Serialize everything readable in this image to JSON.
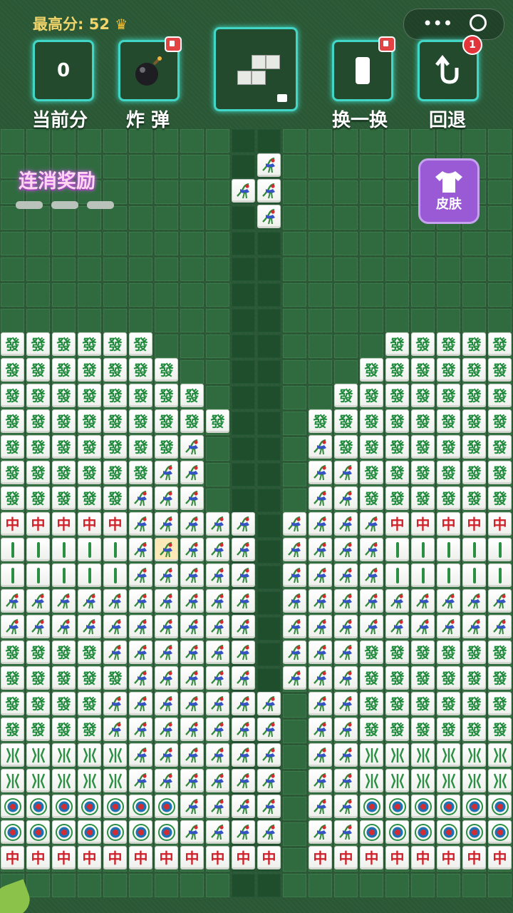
{
  "hud": {
    "best_label": "最高分:",
    "best_value": "52",
    "score_value": "0",
    "score_label": "当前分",
    "bomb_label": "炸 弹",
    "swap_label": "换一换",
    "undo_label": "回退",
    "undo_count": "1",
    "skin_label": "皮肤",
    "streak_label": "连消奖励"
  },
  "colors": {
    "accent": "#41d6c6",
    "tile_green": "#1f8a3c",
    "tile_red": "#d0202a",
    "skin_purple": "#9a5ad6"
  },
  "icons": [
    "bomb-icon",
    "swap-icon",
    "undo-icon",
    "shirt-icon",
    "video-badge-icon",
    "crown-icon"
  ],
  "board": {
    "rows": [
      "FFFFFF..........FFFFF",
      "FFFFFFF.........FFFFFF",
      "FFFFFFFF........FFFFFFF",
      "FFFFFFFFF.......FFFFFFFF",
      "FFFFFFFB........BFFFFFFF",
      "FFFFFFBB........BBFFFFFF",
      "FFFFFBBB........BBFFFFFF",
      "ZZZZZBBBBB..BBBBZZZZZ",
      "LLLLLBYBBB..BBBBLLLLL",
      "LLLLLBBBBB..BBBBLLLLL",
      "BBBBBBBBBB..BBBBBBBBB",
      "BBBBBBBBBB..BBBBBBBBB",
      "FFFFBBBBBB..BBBFFFFFF",
      "FFFFFBBBBB..BBBFFFFFF",
      "FFFFBBBBBBB..BBFFFFFF",
      "FFFFBBBBBBB..BBFFFFFF",
      "WWWWWBBBBBB..BBWWWWWW",
      "WWWWWBBBBBB..BBWWWWWW",
      "CCCCCCCBBBB..BBCCCCCC",
      "CCCCCCCBBBB..BBCCCCCC",
      "ZZZZZZZZZZZ..ZZZZZZZZ"
    ]
  }
}
